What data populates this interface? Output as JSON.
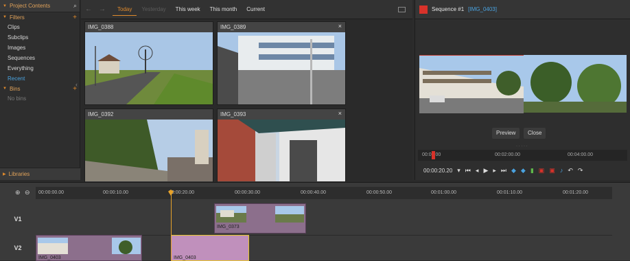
{
  "left_panel": {
    "title": "Project Contents",
    "filters_label": "Filters",
    "filter_items": [
      "Clips",
      "Subclips",
      "Images",
      "Sequences",
      "Everything",
      "Recent"
    ],
    "bins_label": "Bins",
    "bins_empty": "No bins",
    "libraries_label": "Libraries"
  },
  "browser": {
    "tabs": [
      "Today",
      "Yesterday",
      "This week",
      "This month",
      "Current"
    ],
    "thumbnails": [
      "IMG_0388",
      "IMG_0389",
      "IMG_0392",
      "IMG_0393"
    ],
    "close_glyph": "×"
  },
  "preview": {
    "title": "Sequence #1",
    "tag": "[IMG_0403]",
    "preview_button": "Preview",
    "close_button": "Close",
    "ruler_ticks": [
      "00:00:00",
      "00:02:00.00",
      "00:04:00.00"
    ],
    "timecode": "00:00:20.20"
  },
  "timeline": {
    "ruler_ticks": [
      "00:00:00.00",
      "00:00:10.00",
      "00:00:20.00",
      "00:00:30.00",
      "00:00:40.00",
      "00:00:50.00",
      "00:01:00.00",
      "00:01:10.00",
      "00:01:20.00"
    ],
    "tracks": [
      "V1",
      "V2"
    ],
    "clips": {
      "v1": "IMG_0373",
      "v2a": "IMG_0403",
      "v2b": "IMG_0403"
    }
  },
  "colors": {
    "accent": "#e08a2c",
    "selection": "#4aa3e0",
    "playhead": "#e8a32a"
  }
}
